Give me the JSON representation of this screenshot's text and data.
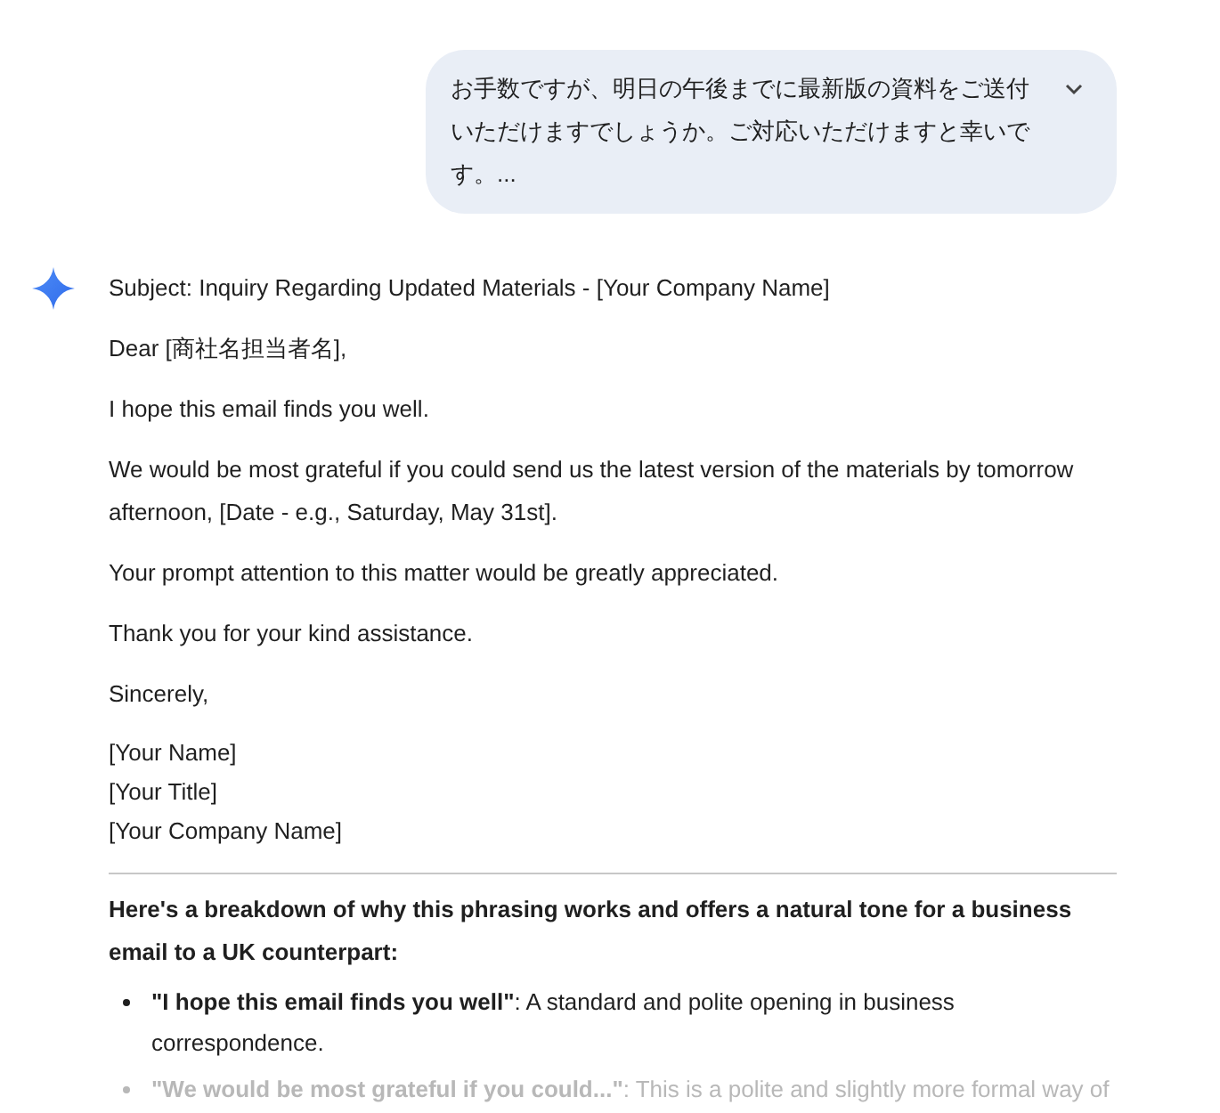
{
  "user_message": {
    "text": "お手数ですが、明日の午後までに最新版の資料をご送付いただけますでしょうか。ご対応いただけますと幸いです。...",
    "expanded": false
  },
  "response": {
    "email_lines": [
      {
        "kind": "paragraph",
        "lines": [
          "Subject: Inquiry Regarding Updated Materials - [Your Company Name]"
        ]
      },
      {
        "kind": "paragraph",
        "lines": [
          "Dear [商社名担当者名],"
        ]
      },
      {
        "kind": "paragraph",
        "lines": [
          "I hope this email finds you well."
        ]
      },
      {
        "kind": "paragraph",
        "lines": [
          "We would be most grateful if you could send us the latest version of the materials by tomorrow afternoon, [Date - e.g., Saturday, May 31st]."
        ]
      },
      {
        "kind": "paragraph",
        "lines": [
          "Your prompt attention to this matter would be greatly appreciated."
        ]
      },
      {
        "kind": "paragraph",
        "lines": [
          "Thank you for your kind assistance."
        ]
      },
      {
        "kind": "paragraph",
        "lines": [
          "Sincerely,"
        ]
      },
      {
        "kind": "signature",
        "lines": [
          "[Your Name]",
          "[Your Title]",
          "[Your Company Name]"
        ]
      }
    ],
    "breakdown_heading": "Here's a breakdown of why this phrasing works and offers a natural tone for a business email to a UK counterpart:",
    "bullets": [
      {
        "text": "**\"I hope this email finds you well\"**: A standard and polite opening in business correspondence.",
        "faded": false
      },
      {
        "text": "**\"We would be most grateful if you could...\"**: This is a polite and slightly more formal way of",
        "faded": true
      }
    ]
  }
}
